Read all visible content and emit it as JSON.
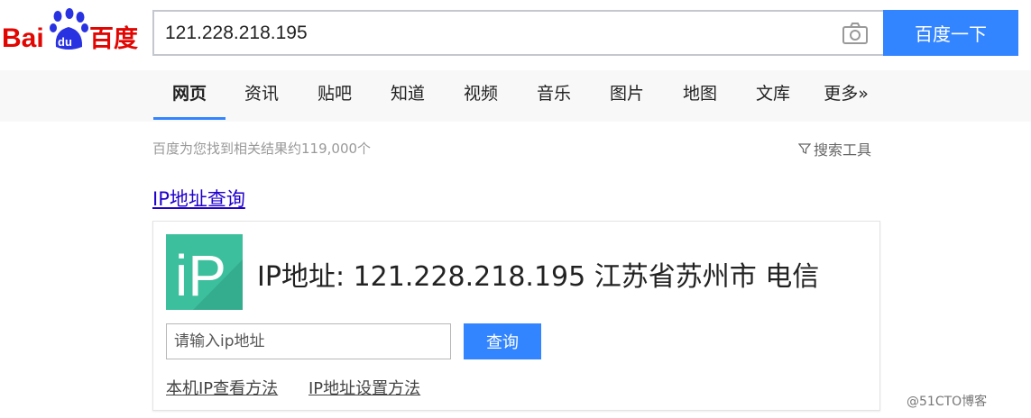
{
  "logo": {
    "text_left": "Bai",
    "paw_text": "du",
    "text_right": "百度"
  },
  "search": {
    "value": "121.228.218.195",
    "button_label": "百度一下"
  },
  "nav": {
    "tabs": [
      {
        "label": "网页"
      },
      {
        "label": "资讯"
      },
      {
        "label": "贴吧"
      },
      {
        "label": "知道"
      },
      {
        "label": "视频"
      },
      {
        "label": "音乐"
      },
      {
        "label": "图片"
      },
      {
        "label": "地图"
      },
      {
        "label": "文库"
      },
      {
        "label": "更多»"
      }
    ],
    "active_tab": "网页"
  },
  "results": {
    "count_text": "百度为您找到相关结果约119,000个",
    "tools_label": "搜索工具"
  },
  "card": {
    "title": "IP地址查询",
    "icon_text": "iP",
    "result_text": "IP地址: 121.228.218.195  江苏省苏州市 电信",
    "input_placeholder": "请输入ip地址",
    "query_button": "查询",
    "link1": "本机IP查看方法",
    "link2": "IP地址设置方法"
  },
  "watermark": "@51CTO博客",
  "colors": {
    "accent": "#3385ff",
    "link": "#2000cc",
    "ip_icon": "#3cbf9d",
    "logo_red": "#e10601",
    "logo_blue": "#2932e1"
  }
}
